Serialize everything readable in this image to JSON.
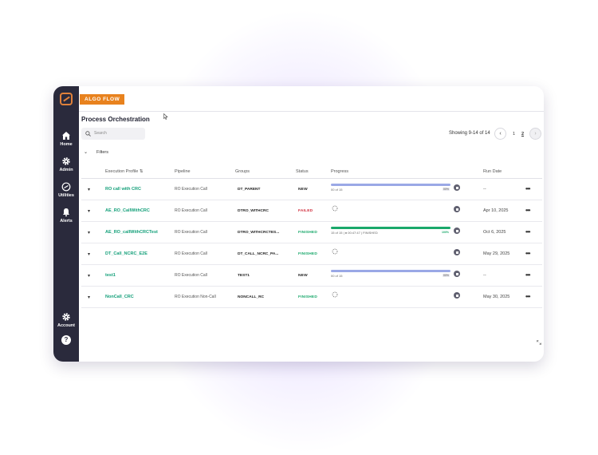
{
  "brand": "ALGO FLOW",
  "sidebar": {
    "items": [
      {
        "label": "Home",
        "icon": "home-icon"
      },
      {
        "label": "Admin",
        "icon": "gear-icon"
      },
      {
        "label": "Utilities",
        "icon": "link-icon"
      },
      {
        "label": "Alerts",
        "icon": "bell-icon"
      }
    ],
    "bottom": [
      {
        "label": "Account",
        "icon": "gear-icon"
      },
      {
        "label": "?",
        "icon": "help-icon"
      }
    ]
  },
  "page": {
    "title": "Process Orchestration",
    "search_placeholder": "Search",
    "showing": "Showing 9-14 of 14",
    "pages": [
      "1",
      "2"
    ],
    "current_page": "2",
    "filters_label": "Filters"
  },
  "table": {
    "headers": {
      "profile": "Execution Profile",
      "pipeline": "Pipeline",
      "groups": "Groups",
      "status": "Status",
      "progress": "Progress",
      "run_date": "Run Date"
    },
    "rows": [
      {
        "profile": "RO call with CRC",
        "pipeline": "RO Execution Call",
        "group": "DT_PARENT",
        "status": "NEW",
        "progress_text": "00 of 15",
        "progress_pct": "00%",
        "date": "--"
      },
      {
        "profile": "AE_RO_CallWithCRC",
        "pipeline": "RO Execution Call",
        "group": "DTRO_WITHCRC",
        "status": "FAILED",
        "progress_text": "",
        "progress_pct": "",
        "date": "Apr 10, 2025"
      },
      {
        "profile": "AE_RO_callWithCRCTest",
        "pipeline": "RO Execution Call",
        "group": "DTRO_WITHCRCTES...",
        "status": "FINISHED",
        "progress_text": "15 of 15 | ● 00:47:47 | FINISHED",
        "progress_pct": "100%",
        "date": "Oct 6, 2025"
      },
      {
        "profile": "DT_Call_NCRC_E2E",
        "pipeline": "RO Execution Call",
        "group": "DT_CALL_NCRC_PA...",
        "status": "FINISHED",
        "progress_text": "",
        "progress_pct": "",
        "date": "May 29, 2025"
      },
      {
        "profile": "test1",
        "pipeline": "RO Execution Call",
        "group": "TEST1",
        "status": "NEW",
        "progress_text": "00 of 15",
        "progress_pct": "00%",
        "date": "--"
      },
      {
        "profile": "NonCall_CRC",
        "pipeline": "RO Execution Non-Call",
        "group": "NONCALL_RC",
        "status": "FINISHED",
        "progress_text": "",
        "progress_pct": "",
        "date": "May 30, 2025"
      }
    ]
  },
  "colors": {
    "accent": "#e8821e",
    "sidebar": "#2a2a3c",
    "link": "#15a07a",
    "failed": "#d02b3a",
    "finished": "#1aa86b",
    "progress_blue": "#9aa8e6"
  }
}
